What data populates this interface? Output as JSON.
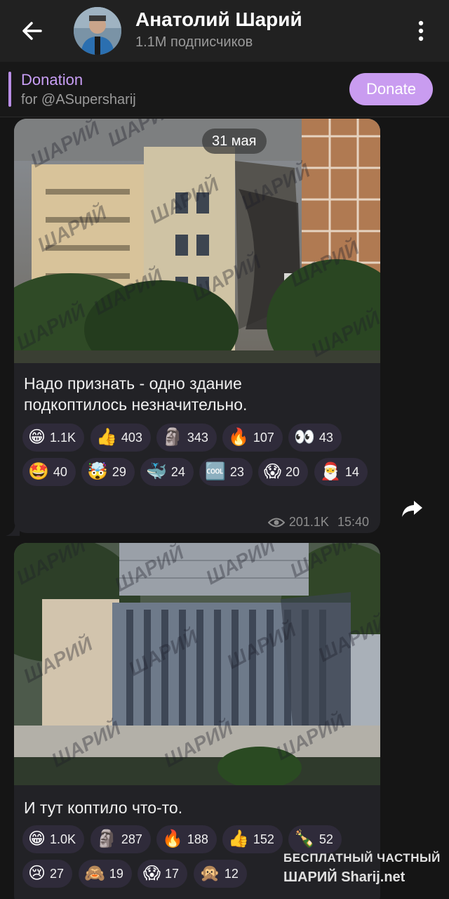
{
  "header": {
    "title": "Анатолий Шарий",
    "subtitle": "1.1M подписчиков"
  },
  "pinned": {
    "title": "Donation",
    "subtitle": "for @ASupersharij",
    "button": "Donate"
  },
  "post1": {
    "date": "31 мая",
    "text": "Надо признать - одно здание подкоптилось незначительно.",
    "reactions": [
      {
        "emoji": "😁",
        "count": "1.1K"
      },
      {
        "emoji": "👍",
        "count": "403"
      },
      {
        "emoji": "🗿",
        "count": "343"
      },
      {
        "emoji": "🔥",
        "count": "107"
      },
      {
        "emoji": "👀",
        "count": "43"
      },
      {
        "emoji": "🤩",
        "count": "40"
      },
      {
        "emoji": "🤯",
        "count": "29"
      },
      {
        "emoji": "🐳",
        "count": "24"
      },
      {
        "emoji": "🆒",
        "count": "23"
      },
      {
        "emoji": "😱",
        "count": "20"
      },
      {
        "emoji": "🎅",
        "count": "14"
      }
    ],
    "views": "201.1K",
    "time": "15:40"
  },
  "post2": {
    "text": "И тут коптило что-то.",
    "reactions": [
      {
        "emoji": "😁",
        "count": "1.0K"
      },
      {
        "emoji": "🗿",
        "count": "287"
      },
      {
        "emoji": "🔥",
        "count": "188"
      },
      {
        "emoji": "👍",
        "count": "152"
      },
      {
        "emoji": "🍾",
        "count": "52"
      },
      {
        "emoji": "😢",
        "count": "27"
      },
      {
        "emoji": "🙈",
        "count": "19"
      },
      {
        "emoji": "😱",
        "count": "17"
      },
      {
        "emoji": "🙊",
        "count": "12"
      }
    ]
  },
  "watermark": {
    "line1": "БЕСПЛАТНЫЙ ЧАСТНЫЙ",
    "line2": "ШАРИЙ Sharij.net"
  },
  "photo_watermark": "ШАРИЙ",
  "colors": {
    "accent": "#c99cf0",
    "bubble": "#222226",
    "chip": "#2f2b3a"
  }
}
